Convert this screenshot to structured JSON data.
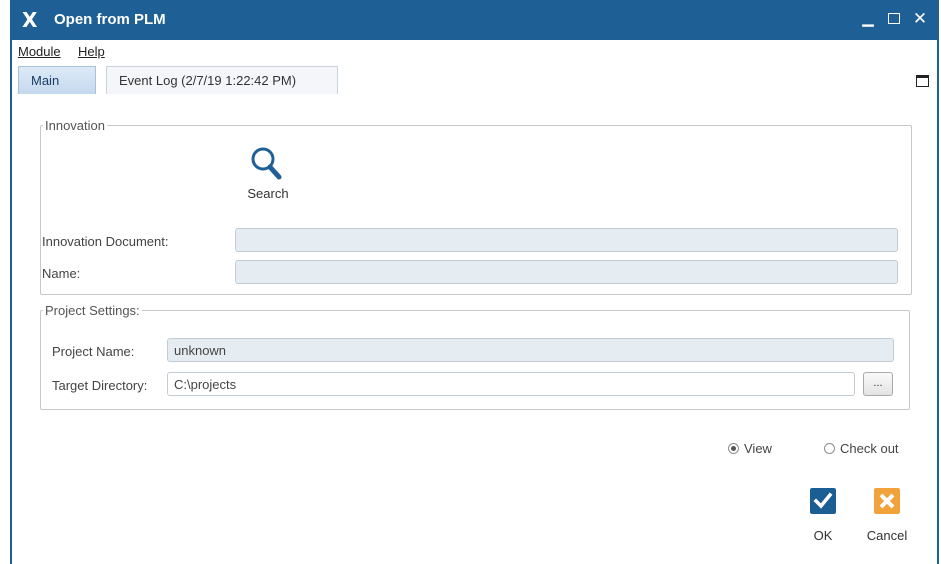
{
  "window": {
    "title": "Open from PLM",
    "logo": "X"
  },
  "menu": [
    {
      "label": "Module"
    },
    {
      "label": "Help"
    }
  ],
  "tabs": [
    {
      "label": "Main"
    },
    {
      "label": "Event Log (2/7/19 1:22:42 PM)"
    }
  ],
  "innovation": {
    "legend": "Innovation",
    "search_label": "Search",
    "document_label": "Innovation Document:",
    "document_value": "",
    "name_label": "Name:",
    "name_value": ""
  },
  "project": {
    "legend": "Project Settings:",
    "name_label": "Project Name:",
    "name_value": "unknown",
    "dir_label": "Target Directory:",
    "dir_value": "C:\\projects",
    "browse_label": "..."
  },
  "mode": {
    "view_label": "View",
    "checkout_label": "Check out",
    "selected": "view"
  },
  "actions": {
    "ok_label": "OK",
    "cancel_label": "Cancel"
  },
  "colors": {
    "titlebar": "#1e5f96",
    "ok": "#1b5e93",
    "cancel": "#f0a33a"
  },
  "icons": [
    "search-icon",
    "checkmark-icon",
    "cancel-x-icon",
    "close-icon",
    "minimize-icon",
    "maximize-icon"
  ]
}
